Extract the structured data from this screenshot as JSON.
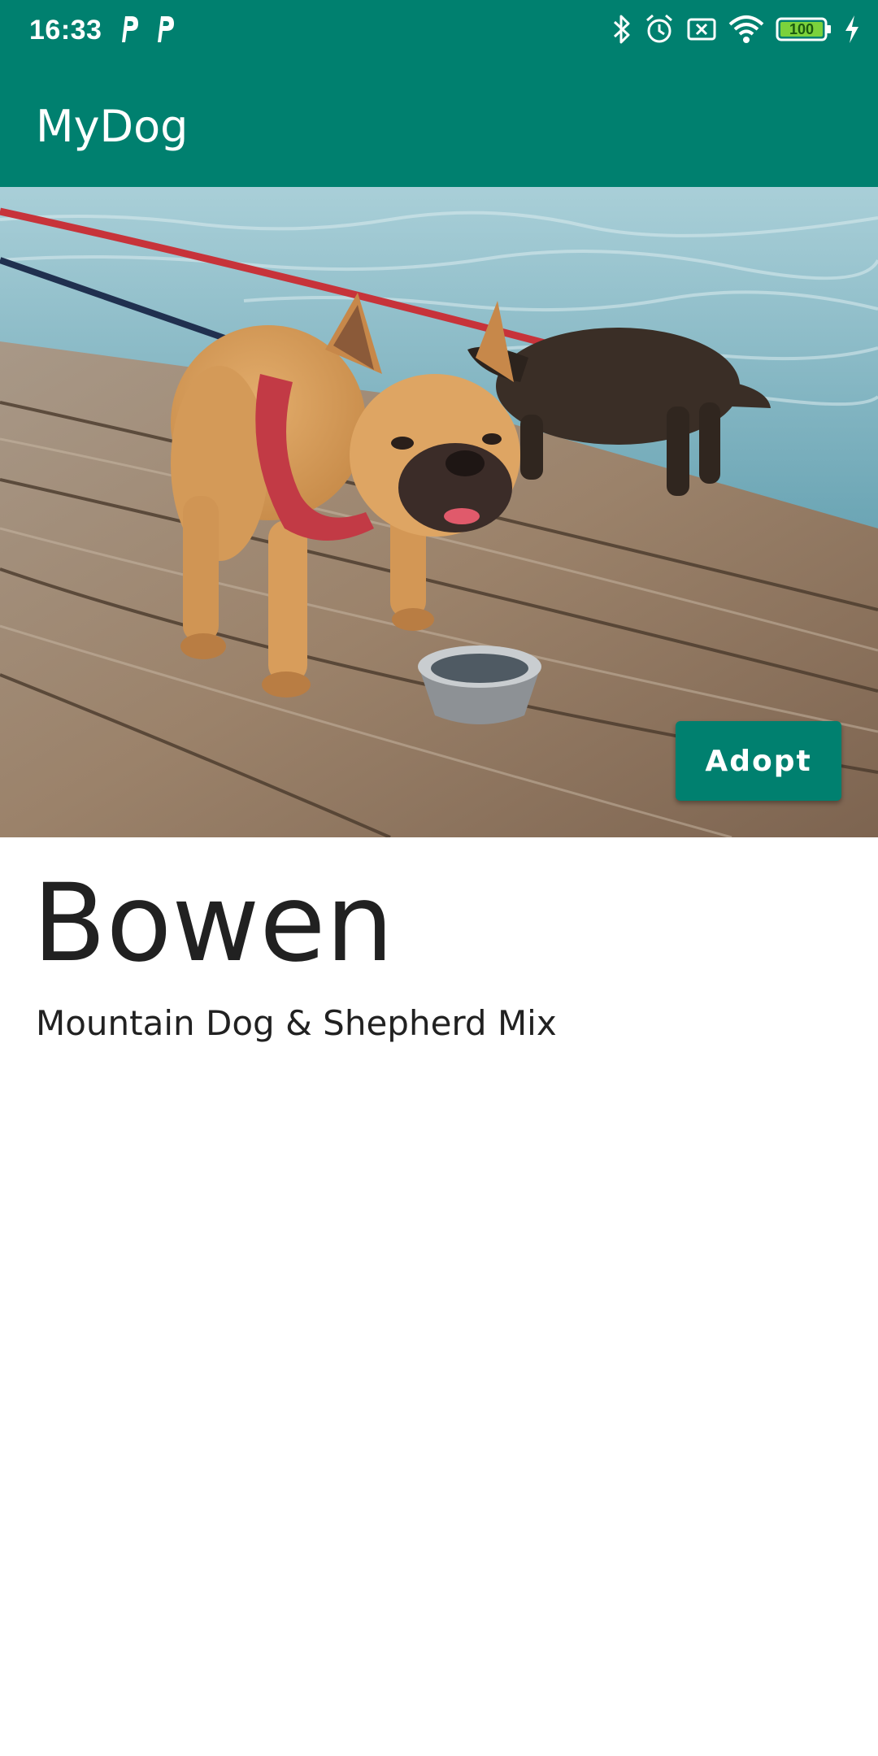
{
  "status_bar": {
    "time": "16:33",
    "left_icons": [
      "p-notification-icon",
      "p-notification-icon"
    ],
    "right_icons": [
      "bluetooth-icon",
      "alarm-icon",
      "no-sim-icon",
      "wifi-icon",
      "battery-icon",
      "charging-icon"
    ],
    "battery": "100"
  },
  "app_bar": {
    "title": "MyDog"
  },
  "hero": {
    "adopt_label": "Adopt"
  },
  "dog": {
    "name": "Bowen",
    "breed": "Mountain Dog & Shepherd Mix"
  },
  "colors": {
    "primary": "#00806f",
    "text": "#212121",
    "background": "#ffffff"
  }
}
